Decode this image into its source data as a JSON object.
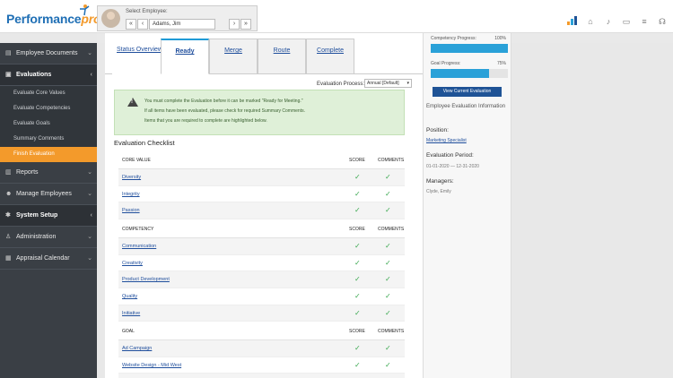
{
  "app": {
    "logo_main": "Performance",
    "logo_accent": "pro"
  },
  "employee": {
    "label": "Select Employee:",
    "name": "Adams, Jim",
    "nav": [
      "«",
      "‹",
      "›",
      "»"
    ]
  },
  "sidebar": {
    "items": [
      {
        "label": "Employee Documents",
        "icon": "document-icon"
      },
      {
        "label": "Evaluations",
        "icon": "evaluations-icon"
      },
      {
        "label": "Reports",
        "icon": "reports-icon"
      },
      {
        "label": "Manage Employees",
        "icon": "users-icon"
      },
      {
        "label": "System Setup",
        "icon": "gear-icon"
      },
      {
        "label": "Administration",
        "icon": "person-icon"
      },
      {
        "label": "Appraisal Calendar",
        "icon": "calendar-icon"
      }
    ],
    "subitems": [
      "Evaluate Core Values",
      "Evaluate Competencies",
      "Evaluate Goals",
      "Summary Comments",
      "Finish Evaluation"
    ]
  },
  "tabs": [
    "Status Overview",
    "Ready",
    "Merge",
    "Route",
    "Complete"
  ],
  "process": {
    "label": "Evaluation Process:",
    "value": "Annual [Default]"
  },
  "alert": {
    "lines": [
      "You must complete the Evaluation before it can be marked \"Ready for Meeting.\"",
      "If all items have been evaluated, please check for required Summary Comments.",
      "Items that you are required to complete are highlighted below."
    ]
  },
  "checklist": {
    "title": "Evaluation Checklist",
    "score_label": "SCORE",
    "comments_label": "COMMENTS",
    "sections": [
      {
        "name": "CORE VALUE",
        "items": [
          "Diversity",
          "Integrity",
          "Passion"
        ]
      },
      {
        "name": "COMPETENCY",
        "items": [
          "Communication",
          "Creativity",
          "Product Development",
          "Quality",
          "Initiative"
        ]
      },
      {
        "name": "GOAL",
        "items": [
          "Ad Campaign",
          "Website Design - Mid West"
        ]
      }
    ]
  },
  "right_panel": {
    "competency_label": "Competency Progress:",
    "competency_value": "100%",
    "competency_pct": 100,
    "goal_label": "Goal Progress:",
    "goal_value": "75%",
    "goal_pct": 75,
    "button": "View Current Evaluation",
    "info_title": "Employee Evaluation Information",
    "position_label": "Position:",
    "position_value": "Marketing Specialist",
    "period_label": "Evaluation Period:",
    "period_value": "01-01-2020 — 12-31-2020",
    "managers_label": "Managers:",
    "managers_value": "Clyde, Emily"
  },
  "top_icons": [
    "chart-icon",
    "home-icon",
    "bell-icon",
    "id-card-icon",
    "settings-sliders-icon",
    "headset-icon"
  ]
}
